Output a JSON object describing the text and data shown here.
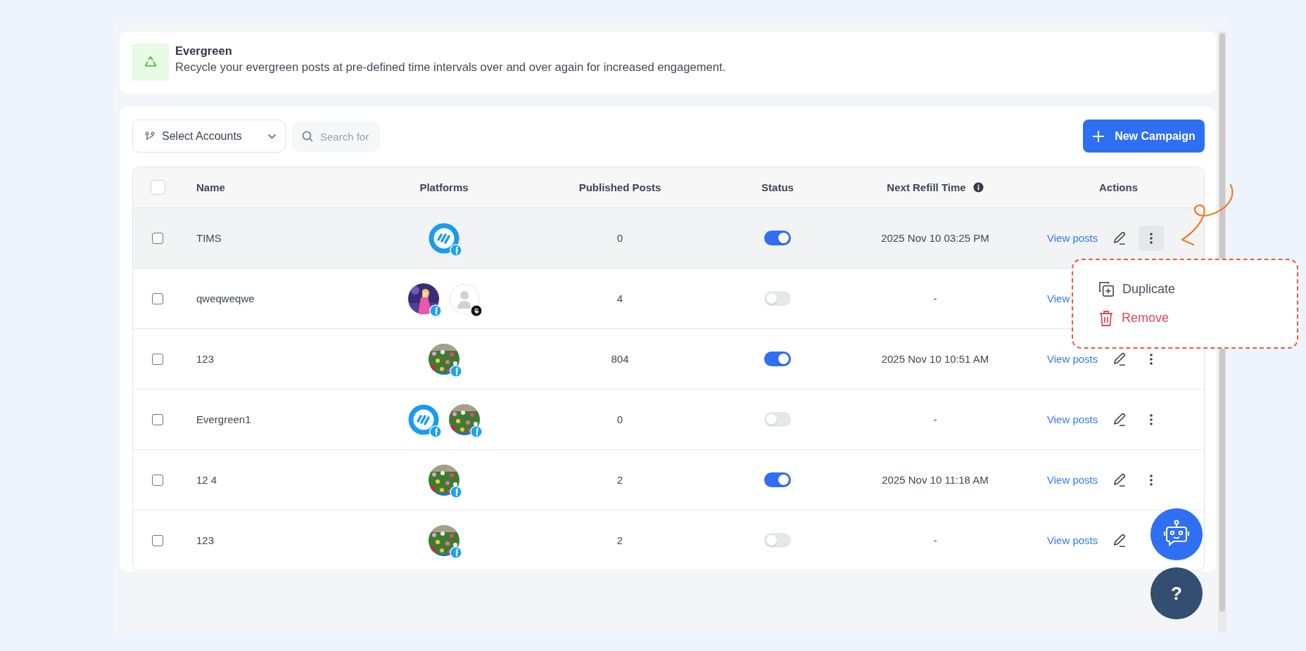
{
  "header": {
    "title": "Evergreen",
    "description": "Recycle your evergreen posts at pre-defined time intervals over and over again for increased engagement."
  },
  "toolbar": {
    "account_select": "Select Accounts",
    "search": {
      "placeholder": "Search for"
    },
    "new_button": "New Campaign"
  },
  "table": {
    "all_checked": false,
    "columns": [
      "Name",
      "Platforms",
      "Published Posts",
      "Status",
      "Next Refill Time",
      "Actions"
    ],
    "rows": [
      {
        "name": "TIMS",
        "checked": false,
        "hovered": true,
        "menu_open": true,
        "platforms": [
          {
            "kind": "logo",
            "badge": {
              "kind": "facebook"
            }
          }
        ],
        "published": "0",
        "enabled": true,
        "next_refill": "2025 Nov 10 03:25 PM",
        "action_link": "View posts",
        "edit_visible": true,
        "more_visible": true
      },
      {
        "name": "qweqweqwe",
        "checked": false,
        "hovered": false,
        "platforms": [
          {
            "badge": {
              "kind": "facebook"
            }
          },
          {
            "kind": "blank",
            "badge": {
              "kind": "threads"
            }
          }
        ],
        "published": "4",
        "enabled": false,
        "next_refill": "-",
        "action_link": "View",
        "edit_visible": false,
        "more_visible": false
      },
      {
        "name": "123",
        "checked": false,
        "hovered": false,
        "menu_open": false,
        "platforms": [
          {
            "kind": "flowers",
            "badge": {
              "kind": "facebook"
            }
          }
        ],
        "published": "804",
        "enabled": true,
        "next_refill": "2025 Nov 10 10:51 AM",
        "action_link": "View posts",
        "edit_visible": true,
        "more_visible": true
      },
      {
        "name": "Evergreen1",
        "checked": false,
        "hovered": false,
        "menu_open": false,
        "platforms": [
          {
            "kind": "logo",
            "badge": {
              "kind": "facebook"
            }
          },
          {
            "kind": "flowers",
            "badge": {
              "kind": "facebook"
            }
          }
        ],
        "published": "0",
        "enabled": false,
        "next_refill": "-",
        "action_link": "View posts",
        "edit_visible": true,
        "more_visible": true
      },
      {
        "name": "12 4",
        "checked": false,
        "hovered": false,
        "menu_open": false,
        "platforms": [
          {
            "kind": "flowers",
            "badge": {
              "kind": "facebook"
            }
          }
        ],
        "published": "2",
        "enabled": true,
        "next_refill": "2025 Nov 10 11:18 AM",
        "action_link": "View posts",
        "edit_visible": true,
        "more_visible": true
      },
      {
        "name": "123",
        "checked": false,
        "hovered": false,
        "platforms": [
          {
            "kind": "flowers",
            "badge": {
              "kind": "facebook"
            }
          }
        ],
        "published": "2",
        "enabled": false,
        "next_refill": "-",
        "action_link": "View posts",
        "edit_visible": true,
        "more_visible": false
      }
    ]
  },
  "row_menu": {
    "items": [
      {
        "label": "Duplicate",
        "kind": "default"
      },
      {
        "label": "Remove",
        "kind": "danger"
      }
    ]
  },
  "help_button": "?"
}
